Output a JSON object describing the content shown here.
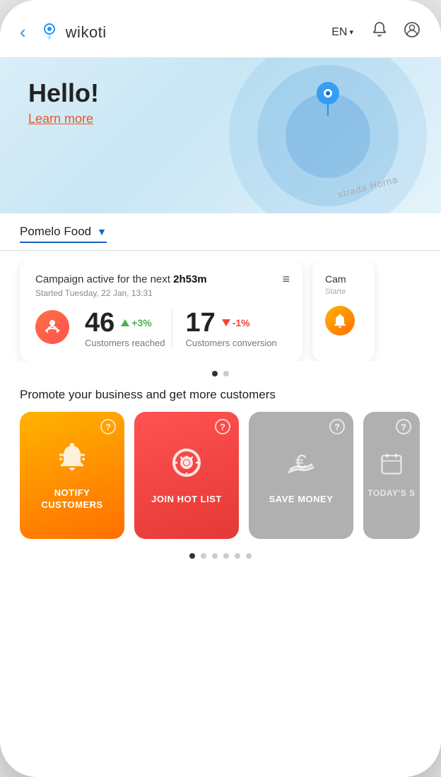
{
  "header": {
    "back_label": "‹",
    "logo_text": "wikoti",
    "lang": "EN",
    "lang_chevron": "▾"
  },
  "hero": {
    "greeting": "Hello!",
    "learn_more": "Learn more",
    "map_road": "strada Horna"
  },
  "selector": {
    "value": "Pomelo Food",
    "chevron": "▼"
  },
  "campaign_card": {
    "title_prefix": "Campaign active for the next ",
    "title_time": "2h53m",
    "subtitle": "Started Tuesday, 22 Jan, 13:31",
    "menu_icon": "≡",
    "stat1_number": "46",
    "stat1_change": "+3%",
    "stat1_label": "Customers reached",
    "stat2_number": "17",
    "stat2_change": "-1%",
    "stat2_label": "Customers conversion"
  },
  "dots": {
    "campaign_active": 0,
    "campaign_total": 2,
    "promo_active": 0,
    "promo_total": 6
  },
  "promote": {
    "title": "Promote your business and get more customers",
    "cards": [
      {
        "id": "notify",
        "label": "NOTIFY\nCUSTOMERS",
        "type": "orange",
        "icon": "bell"
      },
      {
        "id": "hotlist",
        "label": "JOIN HOT LIST",
        "type": "red",
        "icon": "gear"
      },
      {
        "id": "savemoney",
        "label": "SAVE MONEY",
        "type": "gray",
        "icon": "money"
      },
      {
        "id": "today",
        "label": "TODAY'S S",
        "type": "gray-partial",
        "icon": "today"
      }
    ]
  }
}
